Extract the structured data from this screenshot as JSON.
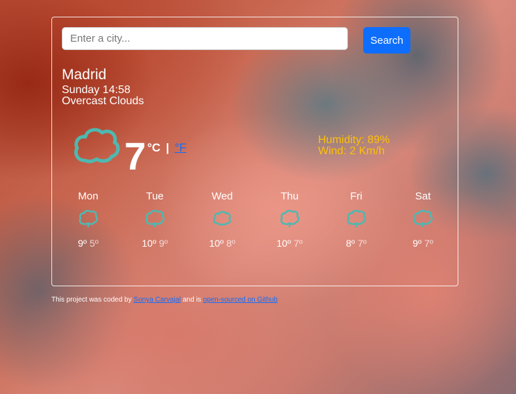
{
  "search": {
    "placeholder": "Enter a city...",
    "button_label": "Search"
  },
  "current": {
    "city": "Madrid",
    "datetime": "Sunday 14:58",
    "description": "Overcast Clouds",
    "icon": "cloud-icon",
    "temperature": "7",
    "unit_celsius": "°C",
    "unit_separator": "|",
    "unit_fahrenheit": "°F",
    "humidity": "Humidity: 89%",
    "wind": "Wind: 2 Km/h"
  },
  "forecast": [
    {
      "day": "Mon",
      "max": "9º",
      "min": "5º",
      "icon": "cloud-icon"
    },
    {
      "day": "Tue",
      "max": "10º",
      "min": "9º",
      "icon": "cloud-icon"
    },
    {
      "day": "Wed",
      "max": "10º",
      "min": "8º",
      "icon": "cloud-icon"
    },
    {
      "day": "Thu",
      "max": "10º",
      "min": "7º",
      "icon": "cloud-icon"
    },
    {
      "day": "Fri",
      "max": "8º",
      "min": "7º",
      "icon": "cloud-icon"
    },
    {
      "day": "Sat",
      "max": "9º",
      "min": "7º",
      "icon": "cloud-icon"
    }
  ],
  "footer": {
    "prefix": "This project was coded by",
    "author_link": "Sonya Carvajal",
    "middle": "and is",
    "source_link": "open-sourced on Github"
  },
  "colors": {
    "accent": "#0d6efd",
    "highlight": "#ffc107",
    "icon": "#4fb8b0"
  }
}
